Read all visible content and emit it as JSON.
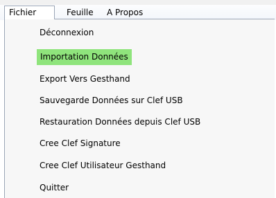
{
  "menubar": {
    "items": [
      {
        "label": "Fichier"
      },
      {
        "label": "Feuille"
      },
      {
        "label": "A Propos"
      }
    ]
  },
  "dropdown": {
    "items": [
      {
        "label": "Déconnexion"
      },
      {
        "label": "Importation Données",
        "highlighted": true
      },
      {
        "label": "Export Vers Gesthand"
      },
      {
        "label": "Sauvegarde Données sur Clef USB"
      },
      {
        "label": "Restauration Données depuis Clef USB"
      },
      {
        "label": "Cree Clef Signature"
      },
      {
        "label": "Cree Clef Utilisateur Gesthand"
      },
      {
        "label": "Quitter"
      }
    ]
  },
  "colors": {
    "highlight": "#8fe47c",
    "annotation_arrow": "#c00000",
    "menu_border": "#9aa5b5"
  },
  "icons": {
    "annotation": "red-arrow-pointing-left"
  }
}
